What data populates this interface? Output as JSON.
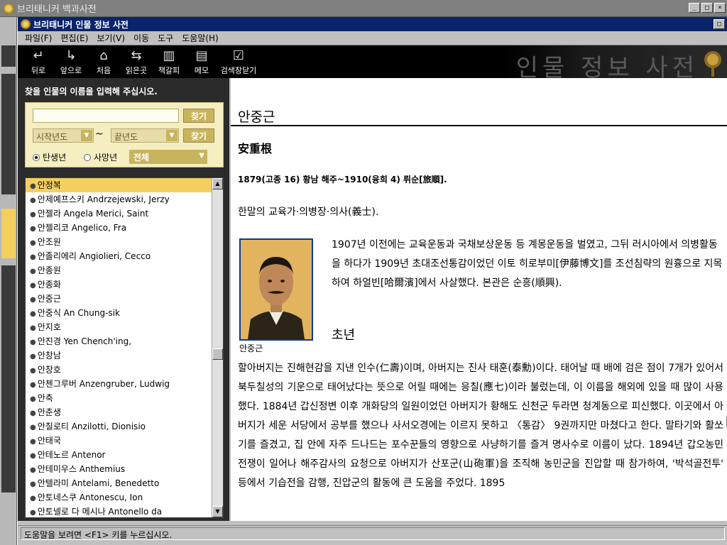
{
  "outer_window": {
    "title": "브리태니커 백과사전"
  },
  "inner_window": {
    "title": "브리태니커 인물 정보 사전"
  },
  "menu": [
    "파일(F)",
    "편집(E)",
    "보기(V)",
    "이동",
    "도구",
    "도움말(H)"
  ],
  "toolbar": {
    "buttons": [
      {
        "label": "뒤로",
        "icon": "back-icon"
      },
      {
        "label": "앞으로",
        "icon": "forward-icon"
      },
      {
        "label": "처음",
        "icon": "home-icon"
      },
      {
        "label": "읽은곳",
        "icon": "history-icon"
      },
      {
        "label": "책갈피",
        "icon": "bookmark-icon"
      },
      {
        "label": "메모",
        "icon": "memo-icon"
      },
      {
        "label": "검색창닫기",
        "icon": "close-search-icon"
      }
    ],
    "banner": "인물 정보 사전"
  },
  "search": {
    "heading": "찾을 인물의 이름을 입력해 주십시오.",
    "name_value": "",
    "find_label": "찾기",
    "start_year": "시작년도",
    "end_year": "끝년도",
    "year_find_label": "찾기",
    "radio_birth": "탄생년",
    "radio_death": "사망년",
    "period_value": "전체"
  },
  "list": [
    "안정복",
    "안제예프스키  Andrzejewski, Jerzy",
    "안젤라  Angela Merici, Saint",
    "안젤리코  Angelico, Fra",
    "안조원",
    "안졸리에리  Angiolieri, Cecco",
    "안종원",
    "안종화",
    "안중근",
    "안중식  An Chung-sik",
    "안지호",
    "안진경  Yen Chench'ing,",
    "안창남",
    "안창호",
    "안첸그루버  Anzengruber, Ludwig",
    "안축",
    "안춘생",
    "안칠로티  Anzilotti, Dionisio",
    "안태국",
    "안테노르  Antenor",
    "안테미우스  Anthemius",
    "안텔라미  Antelami, Benedetto",
    "안토네스쿠  Antonescu, Ion",
    "안토넬로 다 메시나  Antonello da"
  ],
  "article": {
    "title": "안중근",
    "hanja": "安重根",
    "dates": "1879(고종 16) 황남 해주~1910(융희 4) 뤼순[旅順].",
    "role": "한말의 교육가·의병장·의사(義士).",
    "caption": "안중근",
    "para1": "1907년 이전에는 교육운동과 국채보상운동 등 계몽운동을 벌였고, 그뒤 러시아에서 의병활동을 하다가 1909년 초대조선통감이었던 이토 히로부미[伊藤博文]를 조선침략의 원흉으로 지목하여 하얼빈[哈爾濱]에서 사살했다. 본관은 순흥(順興).",
    "subhead": "초년",
    "para2": "할아버지는 진해현감을 지낸 인수(仁壽)이며, 아버지는 진사 태훈(泰勳)이다. 태어날 때 배에 검은 점이 7개가 있어서 북두칠성의 기운으로 태어났다는 뜻으로 어릴 때에는 응칠(應七)이라 불렀는데, 이 이름을 해외에 있을 때 많이 사용했다. 1884년 갑신정변 이후 개화당의 일원이었던 아버지가 황해도 신천군 두라면 청계동으로 피신했다. 이곳에서 아버지가 세운 서당에서 공부를 했으나 사서오경에는 이르지 못하고 〈통감〉 9권까지만 마쳤다고 한다. 말타기와 활쏘기를 즐겼고, 집 안에 자주 드나드는 포수꾼들의 영향으로 사냥하기를 즐겨 명사수로 이름이 났다. 1894년 갑오농민전쟁이 일어나 해주감사의 요청으로 아버지가 산포군(山砲軍)을 조직해 농민군을 진압할 때 참가하여, '박석골전투' 등에서 기습전을 감행, 진압군의 활동에 큰 도움을 주었다. 1895"
  },
  "status": "도움말을 보려면 <F1> 키를 누르십시오."
}
